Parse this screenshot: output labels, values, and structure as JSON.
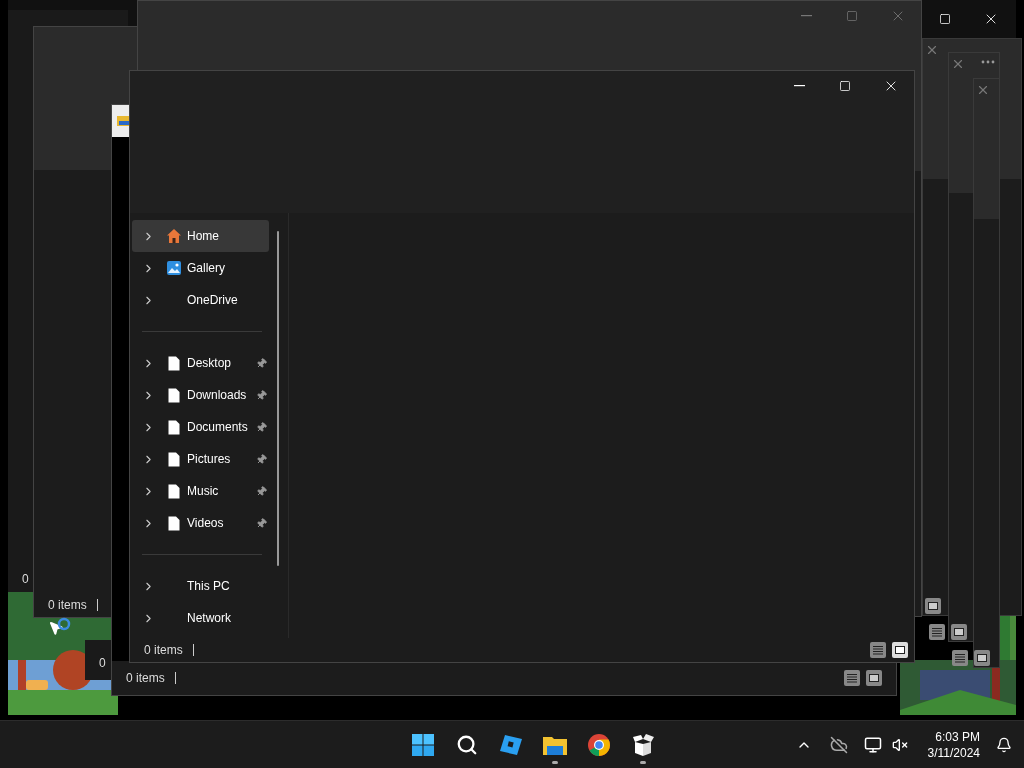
{
  "background_windows": [
    {
      "status": "0"
    },
    {
      "status": "0 items"
    },
    {
      "status": "0"
    },
    {
      "status": "0 items"
    }
  ],
  "front_window": {
    "nav_groups": [
      [
        {
          "label": "Home",
          "kind": "home",
          "selected": true,
          "pinned": false
        },
        {
          "label": "Gallery",
          "kind": "gallery",
          "selected": false,
          "pinned": false
        },
        {
          "label": "OneDrive",
          "kind": "plain",
          "selected": false,
          "pinned": false
        }
      ],
      [
        {
          "label": "Desktop",
          "kind": "document",
          "selected": false,
          "pinned": true
        },
        {
          "label": "Downloads",
          "kind": "document",
          "selected": false,
          "pinned": true
        },
        {
          "label": "Documents",
          "kind": "document",
          "selected": false,
          "pinned": true
        },
        {
          "label": "Pictures",
          "kind": "document",
          "selected": false,
          "pinned": true
        },
        {
          "label": "Music",
          "kind": "document",
          "selected": false,
          "pinned": true
        },
        {
          "label": "Videos",
          "kind": "document",
          "selected": false,
          "pinned": true
        }
      ],
      [
        {
          "label": "This PC",
          "kind": "plain",
          "selected": false,
          "pinned": false
        },
        {
          "label": "Network",
          "kind": "plain",
          "selected": false,
          "pinned": false
        }
      ]
    ],
    "status": "0 items",
    "view_buttons": [
      {
        "kind": "details",
        "selected": false
      },
      {
        "kind": "tiles",
        "selected": true
      }
    ]
  },
  "taskbar": {
    "apps": [
      {
        "kind": "start",
        "running": false
      },
      {
        "kind": "search",
        "running": false
      },
      {
        "kind": "cube",
        "running": false
      },
      {
        "kind": "folder",
        "running": true
      },
      {
        "kind": "chrome",
        "running": false
      },
      {
        "kind": "box",
        "running": true
      }
    ],
    "time": "6:03 PM",
    "date": "3/11/2024"
  }
}
